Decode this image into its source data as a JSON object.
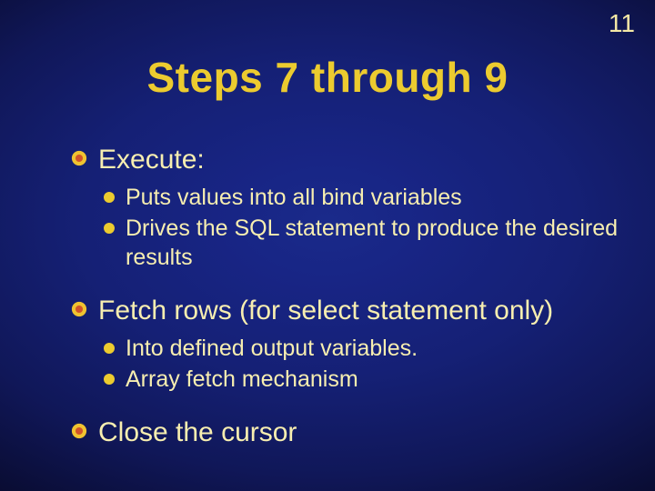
{
  "page_number": "11",
  "title": "Steps 7 through 9",
  "items": [
    {
      "text": "Execute:",
      "sub": [
        "Puts values into all bind variables",
        "Drives the SQL statement to produce the desired results"
      ]
    },
    {
      "text": "Fetch rows (for select statement only)",
      "sub": [
        "Into defined output variables.",
        "Array fetch mechanism"
      ]
    },
    {
      "text": "Close the cursor",
      "sub": []
    }
  ],
  "colors": {
    "title": "#eccb2f",
    "body": "#f7eeb0",
    "bullet_outer": "#f0c330",
    "bullet_inner": "#d1542a"
  }
}
